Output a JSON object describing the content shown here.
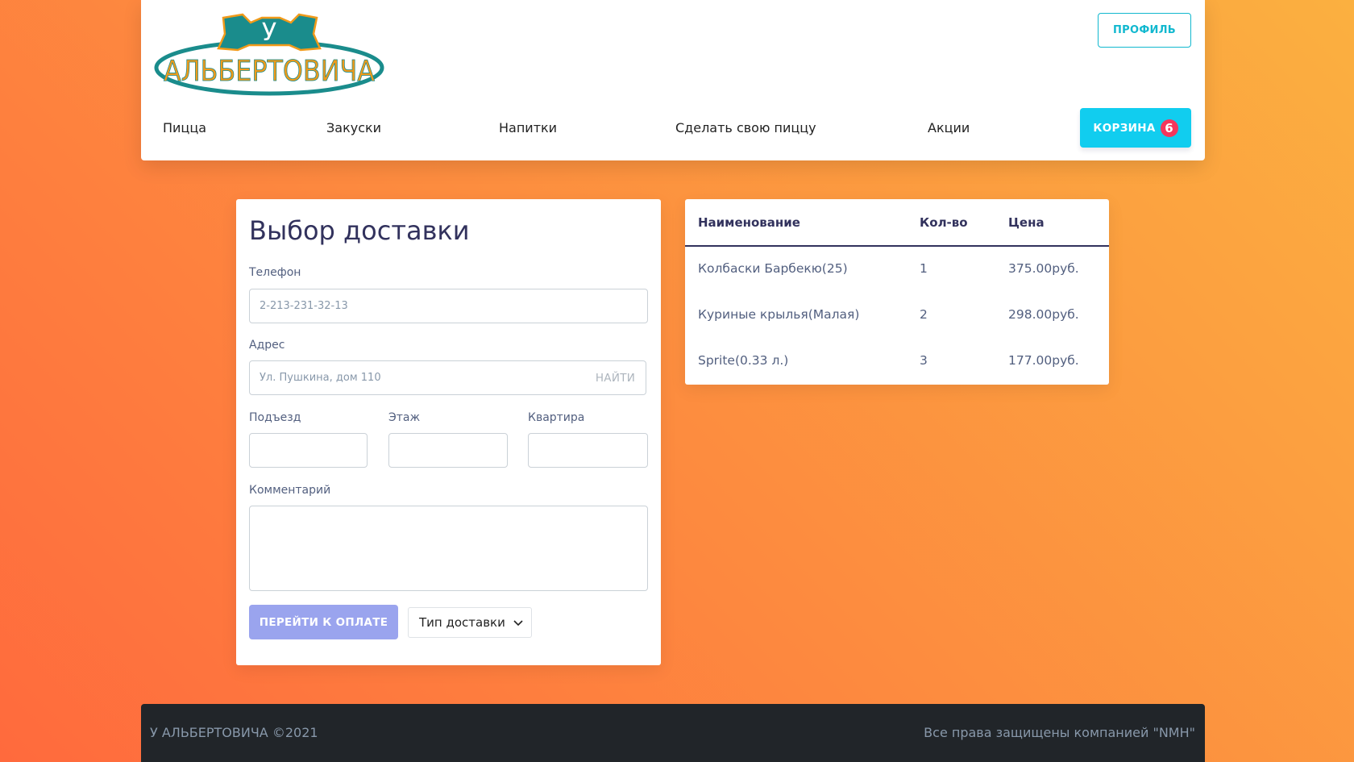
{
  "header": {
    "logo": {
      "letter": "У",
      "name": "АЛЬБЕРТОВИЧА",
      "colors": {
        "teal": "#1a8c8c",
        "orange": "#f09a1a"
      }
    },
    "profile_label": "ПРОФИЛЬ",
    "nav": [
      {
        "label": "Пицца"
      },
      {
        "label": "Закуски"
      },
      {
        "label": "Напитки"
      },
      {
        "label": "Сделать свою пиццу"
      },
      {
        "label": "Акции"
      }
    ],
    "cart": {
      "label": "КОРЗИНА",
      "count": "6"
    }
  },
  "form": {
    "title": "Выбор доставки",
    "phone": {
      "label": "Телефон",
      "placeholder": "2-213-231-32-13"
    },
    "address": {
      "label": "Адрес",
      "placeholder": "Ул. Пушкина, дом 110",
      "find_label": "НАЙТИ"
    },
    "entrance_label": "Подъезд",
    "floor_label": "Этаж",
    "apartment_label": "Квартира",
    "comment_label": "Комментарий",
    "pay_label": "ПЕРЕЙТИ К ОПЛАТЕ",
    "delivery_type": "Тип доставки"
  },
  "order_table": {
    "columns": [
      "Наименование",
      "Кол-во",
      "Цена"
    ],
    "rows": [
      {
        "name": "Колбаски Барбекю(25)",
        "qty": "1",
        "price": "375.00руб."
      },
      {
        "name": "Куриные крылья(Малая)",
        "qty": "2",
        "price": "298.00руб."
      },
      {
        "name": "Sprite(0.33 л.)",
        "qty": "3",
        "price": "177.00руб."
      }
    ]
  },
  "footer": {
    "left": "У АЛЬБЕРТОВИЧА ©2021",
    "right": "Все права защищены компанией \"NMH\""
  },
  "colors": {
    "accent_cyan": "#11cdef",
    "badge_red": "#f5365c",
    "pay_button": "#9aa4ee",
    "footer_bg": "#212529"
  }
}
